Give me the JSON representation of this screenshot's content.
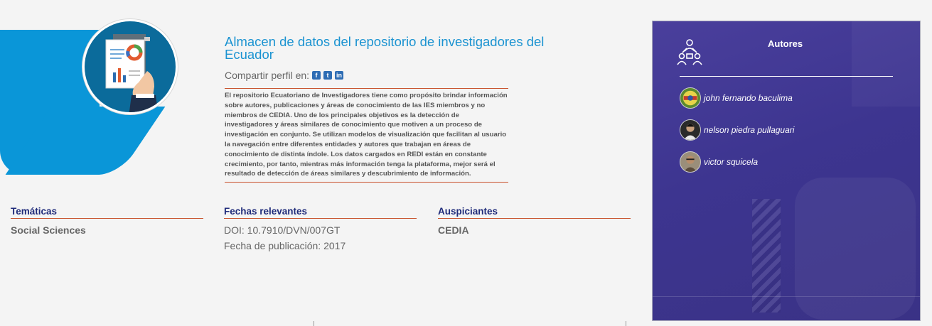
{
  "project": {
    "title": "Almacen de datos del repositorio de investigadores del Ecuador",
    "share_label": "Compartir perfil en:",
    "share_icons": [
      {
        "name": "facebook-icon",
        "glyph": "f"
      },
      {
        "name": "twitter-icon",
        "glyph": "t"
      },
      {
        "name": "linkedin-icon",
        "glyph": "in"
      }
    ],
    "description": "El repositorio Ecuatoriano de Investigadores tiene como propósito brindar información sobre autores, publicaciones y áreas de conocimiento de las IES miembros y no miembros de CEDIA. Uno de los principales objetivos es la detección de investigadores y áreas similares de conocimiento que motiven a un proceso de investigación en conjunto. Se utilizan modelos de visualización que facilitan al usuario la navegación entre diferentes entidades y autores que trabajan en áreas de conocimiento de distinta índole. Los datos cargados en REDI están en constante crecimiento, por tanto, mientras más información tenga la plataforma, mejor será el resultado de detección de áreas similares y descubrimiento de información."
  },
  "meta": {
    "tematicas": {
      "heading": "Temáticas",
      "value": "Social Sciences"
    },
    "fechas": {
      "heading": "Fechas relevantes",
      "doi": "DOI: 10.7910/DVN/007GT",
      "fecha": "Fecha de publicación: 2017"
    },
    "auspiciantes": {
      "heading": "Auspiciantes",
      "value": "CEDIA"
    }
  },
  "authors": {
    "title": "Autores",
    "list": [
      {
        "name": "john fernando baculima"
      },
      {
        "name": "nelson piedra pullaguari"
      },
      {
        "name": "victor squicela"
      }
    ]
  },
  "colors": {
    "accent_blue": "#1b93d1",
    "hero_blue": "#0a96d8",
    "heading_navy": "#1f2b7a",
    "rule_orange": "#c8522d",
    "panel_purple": "#3d3590"
  }
}
